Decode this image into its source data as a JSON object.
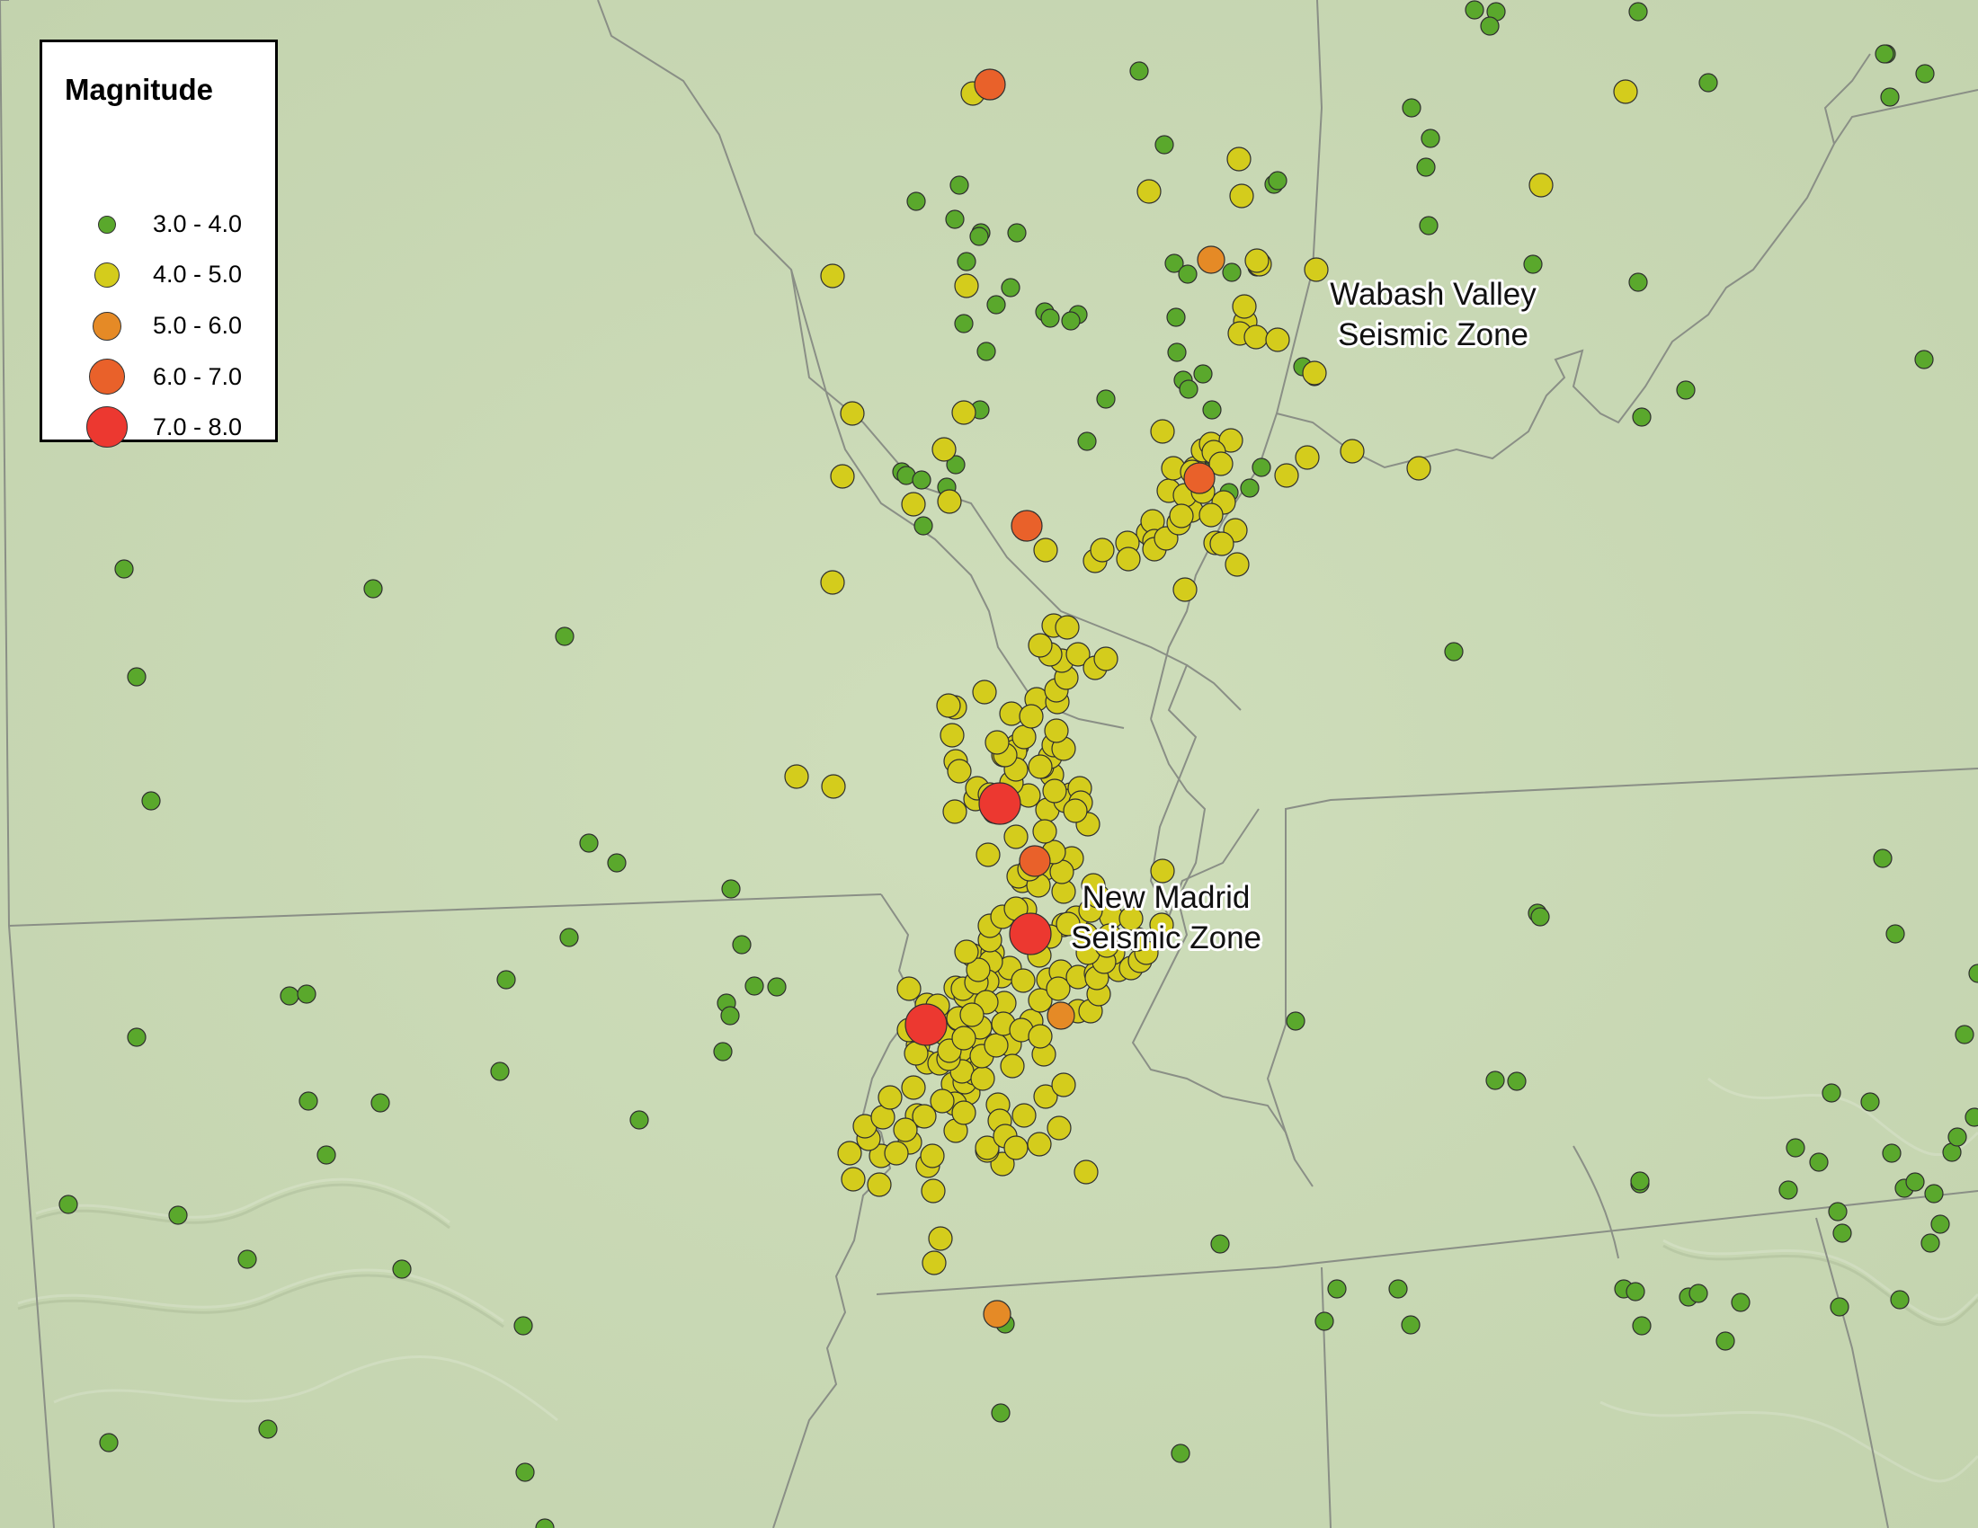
{
  "legend": {
    "title": "Magnitude",
    "classes": [
      {
        "label": "3.0 - 4.0",
        "color": "#5aa82c"
      },
      {
        "label": "4.0 - 5.0",
        "color": "#d4cc1c"
      },
      {
        "label": "5.0 - 6.0",
        "color": "#e58a26"
      },
      {
        "label": "6.0 - 7.0",
        "color": "#e9612a"
      },
      {
        "label": "7.0 - 8.0",
        "color": "#ec3830"
      }
    ]
  },
  "zones": {
    "wabash_line1": "Wabash Valley",
    "wabash_line2": "Seismic Zone",
    "madrid_line1": "New Madrid",
    "madrid_line2": "Seismic Zone"
  },
  "colors": {
    "background": "#c9d9b4",
    "boundary": "#8a8f86",
    "marker_stroke": "#2f2f2f"
  }
}
